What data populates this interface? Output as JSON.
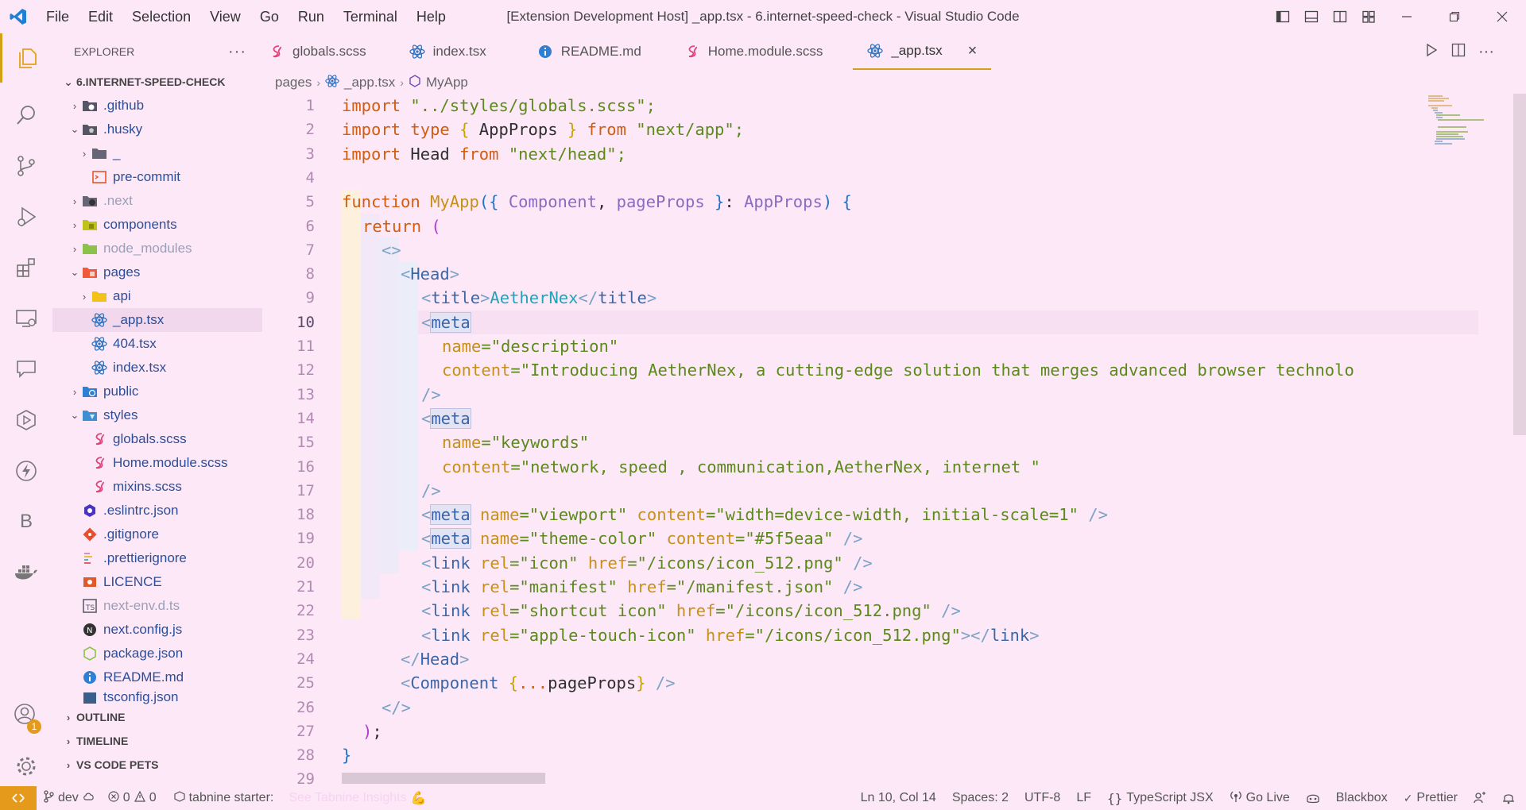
{
  "window": {
    "title": "[Extension Development Host] _app.tsx - 6.internet-speed-check - Visual Studio Code",
    "menu": [
      "File",
      "Edit",
      "Selection",
      "View",
      "Go",
      "Run",
      "Terminal",
      "Help"
    ]
  },
  "colors": {
    "accent": "#d4a016",
    "background": "#fde8f8",
    "remote": "#e69a1c"
  },
  "activity_bar": {
    "icons": [
      "explorer-icon",
      "search-icon",
      "source-control-icon",
      "run-debug-icon",
      "extensions-icon",
      "remote-explorer-icon",
      "chat-icon",
      "dev-containers-icon",
      "thunder-client-icon",
      "b-icon",
      "docker-icon"
    ],
    "b_label": "B",
    "accounts_badge": "1"
  },
  "sidebar": {
    "title": "EXPLORER",
    "more": "···",
    "root": "6.INTERNET-SPEED-CHECK",
    "items": [
      {
        "label": ".github",
        "type": "folder"
      },
      {
        "label": ".husky",
        "type": "folder"
      },
      {
        "label": "_",
        "type": "folder"
      },
      {
        "label": "pre-commit",
        "type": "file"
      },
      {
        "label": ".next",
        "type": "folder"
      },
      {
        "label": "components",
        "type": "folder"
      },
      {
        "label": "node_modules",
        "type": "folder"
      },
      {
        "label": "pages",
        "type": "folder"
      },
      {
        "label": "api",
        "type": "folder"
      },
      {
        "label": "_app.tsx",
        "type": "file"
      },
      {
        "label": "404.tsx",
        "type": "file"
      },
      {
        "label": "index.tsx",
        "type": "file"
      },
      {
        "label": "public",
        "type": "folder"
      },
      {
        "label": "styles",
        "type": "folder"
      },
      {
        "label": "globals.scss",
        "type": "file"
      },
      {
        "label": "Home.module.scss",
        "type": "file"
      },
      {
        "label": "mixins.scss",
        "type": "file"
      },
      {
        "label": ".eslintrc.json",
        "type": "file"
      },
      {
        "label": ".gitignore",
        "type": "file"
      },
      {
        "label": ".prettierignore",
        "type": "file"
      },
      {
        "label": "LICENCE",
        "type": "file"
      },
      {
        "label": "next-env.d.ts",
        "type": "file"
      },
      {
        "label": "next.config.js",
        "type": "file"
      },
      {
        "label": "package.json",
        "type": "file"
      },
      {
        "label": "README.md",
        "type": "file"
      },
      {
        "label": "tsconfig.json",
        "type": "file"
      }
    ],
    "sections": [
      "OUTLINE",
      "TIMELINE",
      "VS CODE PETS"
    ]
  },
  "tabs": [
    {
      "label": "globals.scss",
      "icon": "sass-icon"
    },
    {
      "label": "index.tsx",
      "icon": "react-icon"
    },
    {
      "label": "README.md",
      "icon": "info-icon"
    },
    {
      "label": "Home.module.scss",
      "icon": "sass-icon"
    },
    {
      "label": "_app.tsx",
      "icon": "react-icon",
      "active": true
    }
  ],
  "tab_close": "×",
  "breadcrumb": [
    "pages",
    "_app.tsx",
    "MyApp"
  ],
  "editor": {
    "current_line": 10,
    "line_numbers": [
      "1",
      "2",
      "3",
      "4",
      "5",
      "6",
      "7",
      "8",
      "9",
      "10",
      "11",
      "12",
      "13",
      "14",
      "15",
      "16",
      "17",
      "18",
      "19",
      "20",
      "21",
      "22",
      "23",
      "24",
      "25",
      "26",
      "27",
      "28",
      "29"
    ],
    "lines": {
      "l1": {
        "a": "import",
        "b": " \"../styles/globals.scss\";"
      },
      "l2": {
        "a": "import type",
        "b": " { ",
        "c": "AppProps",
        "d": " } ",
        "e": "from",
        "f": " \"next/app\";"
      },
      "l3": {
        "a": "import",
        "b": " Head ",
        "c": "from",
        "d": " \"next/head\";"
      },
      "l5": {
        "a": "function",
        "b": " MyApp",
        "c": "({ ",
        "d": "Component",
        "e": ", ",
        "f": "pageProps",
        "g": " }",
        "h": ": ",
        "i": "AppProps",
        "j": ") {"
      },
      "l6": {
        "a": "return",
        "b": " ("
      },
      "l7": {
        "a": "<>"
      },
      "l8": {
        "a": "<",
        "b": "Head",
        "c": ">"
      },
      "l9": {
        "a": "<",
        "b": "title",
        "c": ">",
        "d": "AetherNex",
        "e": "</",
        "f": "title",
        "g": ">"
      },
      "l10": {
        "a": "<",
        "b": "meta"
      },
      "l11": {
        "a": "name",
        "b": "=\"description\""
      },
      "l12": {
        "a": "content",
        "b": "=\"Introducing AetherNex, a cutting-edge solution that merges advanced browser technolo"
      },
      "l13": {
        "a": "/>"
      },
      "l14": {
        "a": "<",
        "b": "meta"
      },
      "l15": {
        "a": "name",
        "b": "=\"keywords\""
      },
      "l16": {
        "a": "content",
        "b": "=\"network, speed , communication,AetherNex, internet \""
      },
      "l17": {
        "a": "/>"
      },
      "l18": {
        "a": "<",
        "b": "meta",
        "c": " name",
        "d": "=\"viewport\"",
        "e": " content",
        "f": "=\"width=device-width, initial-scale=1\"",
        "g": " />"
      },
      "l19": {
        "a": "<",
        "b": "meta",
        "c": " name",
        "d": "=\"theme-color\"",
        "e": " content",
        "f": "=\"#5f5eaa\"",
        "g": " />"
      },
      "l20": {
        "a": "<",
        "b": "link",
        "c": " rel",
        "d": "=\"icon\"",
        "e": " href",
        "f": "=\"/icons/icon_512.png\"",
        "g": " />"
      },
      "l21": {
        "a": "<",
        "b": "link",
        "c": " rel",
        "d": "=\"manifest\"",
        "e": " href",
        "f": "=\"/manifest.json\"",
        "g": " />"
      },
      "l22": {
        "a": "<",
        "b": "link",
        "c": " rel",
        "d": "=\"shortcut icon\"",
        "e": " href",
        "f": "=\"/icons/icon_512.png\"",
        "g": " />"
      },
      "l23": {
        "a": "<",
        "b": "link",
        "c": " rel",
        "d": "=\"apple-touch-icon\"",
        "e": " href",
        "f": "=\"/icons/icon_512.png\"",
        "g": "></",
        "h": "link",
        "i": ">"
      },
      "l24": {
        "a": "</",
        "b": "Head",
        "c": ">"
      },
      "l25": {
        "a": "<",
        "b": "Component",
        "c": " {",
        "d": "...",
        "e": "pageProps",
        "f": "}",
        "g": " />"
      },
      "l26": {
        "a": "</>"
      },
      "l27": {
        "a": ")",
        "b": ";"
      },
      "l28": {
        "a": "}"
      }
    }
  },
  "status_bar": {
    "branch": "dev",
    "errors": "0",
    "warnings": "0",
    "tabnine": "tabnine starter:",
    "tabnine_hint": "See Tabnine Insights",
    "cursor": "Ln 10, Col 14",
    "spaces": "Spaces: 2",
    "encoding": "UTF-8",
    "eol": "LF",
    "language": "TypeScript JSX",
    "go_live": "Go Live",
    "blackbox": "Blackbox",
    "prettier": "Prettier"
  }
}
